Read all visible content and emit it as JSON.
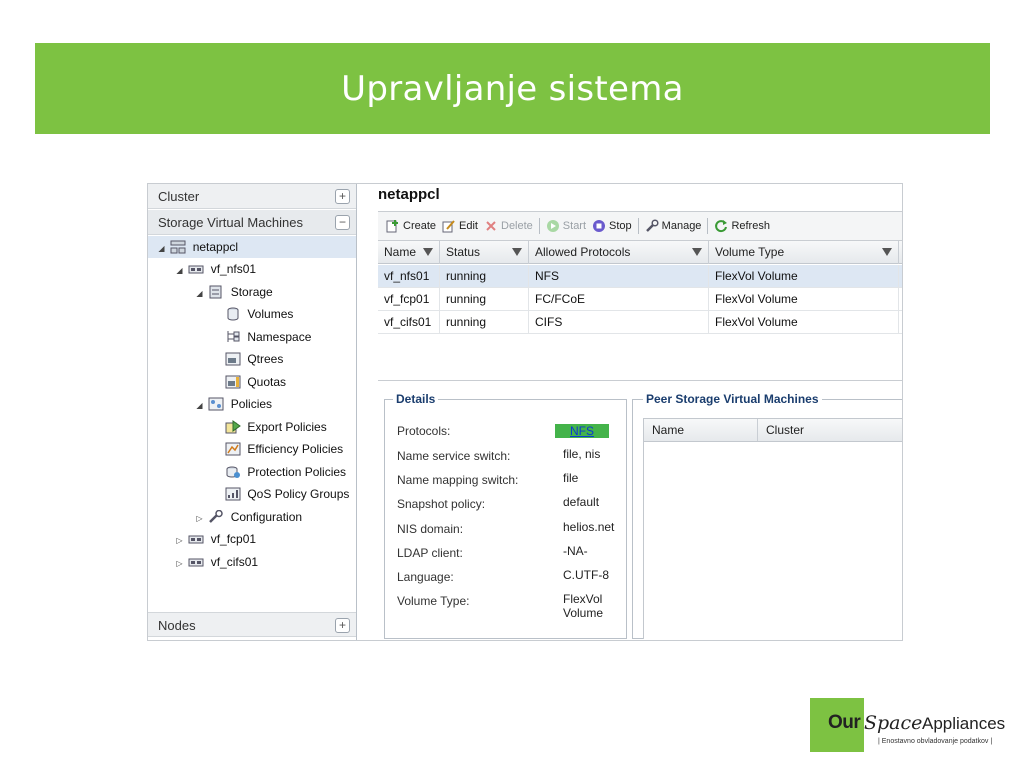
{
  "slide": {
    "title": "Upravljanje sistema"
  },
  "nav": {
    "cluster_label": "Cluster",
    "svm_label": "Storage Virtual Machines",
    "nodes_label": "Nodes",
    "expand_symbol": "+",
    "collapse_symbol": "−",
    "tree": {
      "netappcl": "netappcl",
      "vf_nfs01": "vf_nfs01",
      "storage": "Storage",
      "volumes": "Volumes",
      "namespace": "Namespace",
      "qtrees": "Qtrees",
      "quotas": "Quotas",
      "policies": "Policies",
      "export_policies": "Export Policies",
      "efficiency_policies": "Efficiency Policies",
      "protection_policies": "Protection Policies",
      "qos_policy_groups": "QoS Policy Groups",
      "configuration": "Configuration",
      "vf_fcp01": "vf_fcp01",
      "vf_cifs01": "vf_cifs01"
    }
  },
  "main": {
    "title": "netappcl",
    "toolbar": {
      "create": "Create",
      "edit": "Edit",
      "delete": "Delete",
      "start": "Start",
      "stop": "Stop",
      "manage": "Manage",
      "refresh": "Refresh"
    },
    "grid": {
      "columns": [
        "Name",
        "Status",
        "Allowed Protocols",
        "Volume Type"
      ],
      "rows": [
        [
          "vf_nfs01",
          "running",
          "NFS",
          "FlexVol Volume"
        ],
        [
          "vf_fcp01",
          "running",
          "FC/FCoE",
          "FlexVol Volume"
        ],
        [
          "vf_cifs01",
          "running",
          "CIFS",
          "FlexVol Volume"
        ]
      ],
      "selected_row": 0
    },
    "details": {
      "legend": "Details",
      "protocols_label": "Protocols:",
      "protocols_value": "NFS",
      "name_service_label": "Name service switch:",
      "name_service_value": "file, nis",
      "name_mapping_label": "Name mapping switch:",
      "name_mapping_value": "file",
      "snapshot_label": "Snapshot policy:",
      "snapshot_value": "default",
      "nis_label": "NIS domain:",
      "nis_value": "helios.net",
      "ldap_label": "LDAP client:",
      "ldap_value": "-NA-",
      "language_label": "Language:",
      "language_value": "C.UTF-8",
      "volume_type_label": "Volume Type:",
      "volume_type_value_1": "FlexVol",
      "volume_type_value_2": "Volume"
    },
    "peer": {
      "legend": "Peer Storage Virtual Machines",
      "columns": [
        "Name",
        "Cluster"
      ]
    }
  },
  "logo": {
    "our": "Our",
    "space": "Space",
    "appliances": "Appliances",
    "tagline": "| Enostavno obvladovanje podatkov |"
  },
  "colors": {
    "accent": "#7dc242",
    "selection": "#dde7f3",
    "link": "#0a3ad1"
  }
}
